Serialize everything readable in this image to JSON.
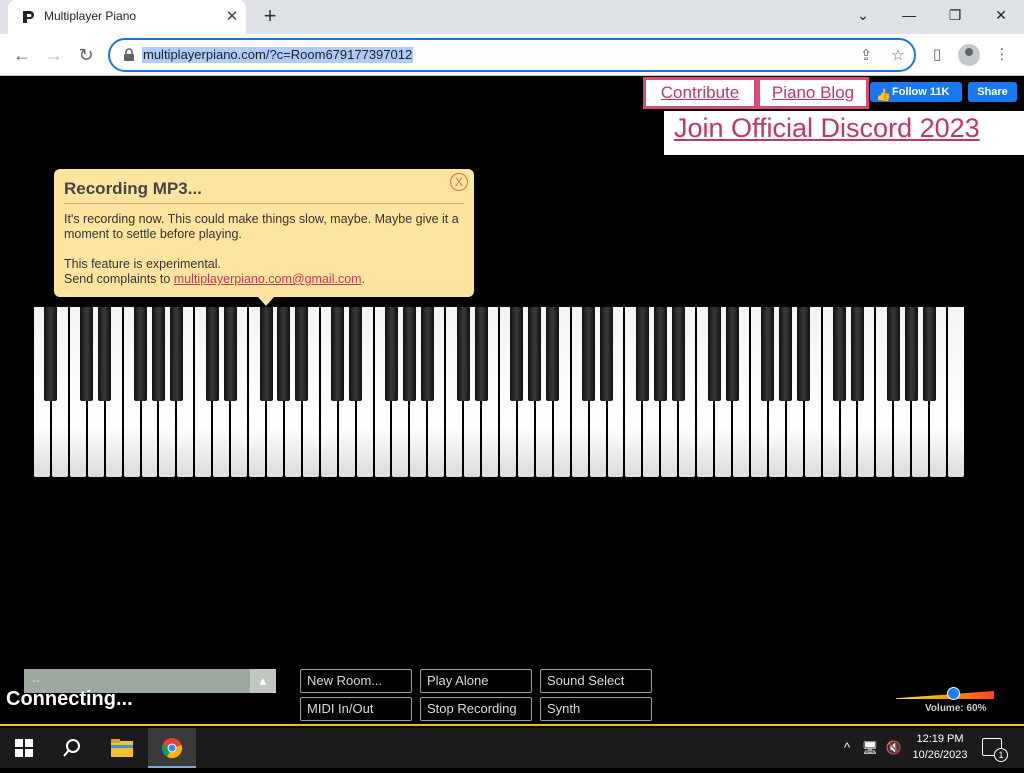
{
  "browser": {
    "tab_title": "Multiplayer Piano",
    "url": "multiplayerpiano.com/?c=Room679177397012"
  },
  "header_links": {
    "contribute": "Contribute",
    "piano_blog": "Piano Blog",
    "fb_follow": "Follow 11K",
    "fb_share": "Share",
    "discord": "Join Official Discord 2023"
  },
  "notice": {
    "title": "Recording MP3...",
    "close": "X",
    "line1": "It's recording now. This could make things slow, maybe. Maybe give it a moment to settle before playing.",
    "line2": "This feature is experimental.",
    "line3_prefix": "Send complaints to ",
    "email": "multiplayerpiano.com@gmail.com",
    "line3_suffix": "."
  },
  "chat": {
    "value": "--"
  },
  "status": "Connecting...",
  "buttons": {
    "new_room": "New Room...",
    "play_alone": "Play Alone",
    "sound_select": "Sound Select",
    "midi": "MIDI In/Out",
    "stop_recording": "Stop Recording",
    "synth": "Synth"
  },
  "volume": {
    "label": "Volume: 60%",
    "level": 0.6
  },
  "taskbar": {
    "time": "12:19 PM",
    "date": "10/26/2023",
    "notification_count": "1"
  },
  "colors": {
    "accent_link": "#c2375e",
    "notice_bg": "#ffe4a0",
    "facebook": "#1877f2"
  }
}
